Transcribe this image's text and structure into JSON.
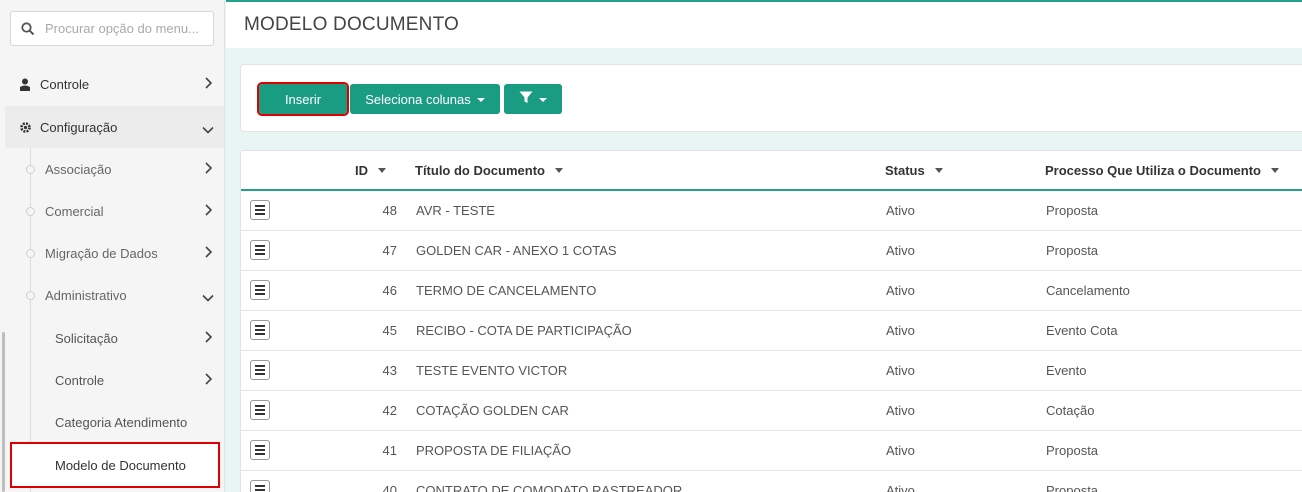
{
  "search": {
    "placeholder": "Procurar opção do menu..."
  },
  "sidebar": {
    "top_items": [
      {
        "label": "Controle",
        "icon": "user-icon"
      },
      {
        "label": "Configuração",
        "icon": "gear-icon"
      }
    ],
    "config_items": [
      {
        "label": "Associação"
      },
      {
        "label": "Comercial"
      },
      {
        "label": "Migração de Dados"
      },
      {
        "label": "Administrativo"
      }
    ],
    "admin_items": [
      {
        "label": "Solicitação"
      },
      {
        "label": "Controle"
      },
      {
        "label": "Categoria Atendimento"
      },
      {
        "label": "Modelo de Documento"
      }
    ]
  },
  "header": {
    "title": "MODELO DOCUMENTO"
  },
  "toolbar": {
    "insert_label": "Inserir",
    "columns_label": "Seleciona colunas",
    "filter_icon": "filter-icon"
  },
  "table": {
    "columns": [
      "ID",
      "Título do Documento",
      "Status",
      "Processo Que Utiliza o Documento"
    ],
    "rows": [
      {
        "id": "48",
        "title": "AVR - TESTE",
        "status": "Ativo",
        "process": "Proposta"
      },
      {
        "id": "47",
        "title": "GOLDEN CAR - ANEXO 1 COTAS",
        "status": "Ativo",
        "process": "Proposta"
      },
      {
        "id": "46",
        "title": "TERMO DE CANCELAMENTO",
        "status": "Ativo",
        "process": "Cancelamento"
      },
      {
        "id": "45",
        "title": "RECIBO - COTA DE PARTICIPAÇÃO",
        "status": "Ativo",
        "process": "Evento Cota"
      },
      {
        "id": "43",
        "title": "TESTE EVENTO VICTOR",
        "status": "Ativo",
        "process": "Evento"
      },
      {
        "id": "42",
        "title": "COTAÇÃO GOLDEN CAR",
        "status": "Ativo",
        "process": "Cotação"
      },
      {
        "id": "41",
        "title": "PROPOSTA DE FILIAÇÃO",
        "status": "Ativo",
        "process": "Proposta"
      },
      {
        "id": "40",
        "title": "CONTRATO DE COMODATO RASTREADOR",
        "status": "Ativo",
        "process": "Proposta"
      }
    ]
  },
  "colors": {
    "accent": "#1a9c83",
    "highlight": "#dd0000"
  }
}
